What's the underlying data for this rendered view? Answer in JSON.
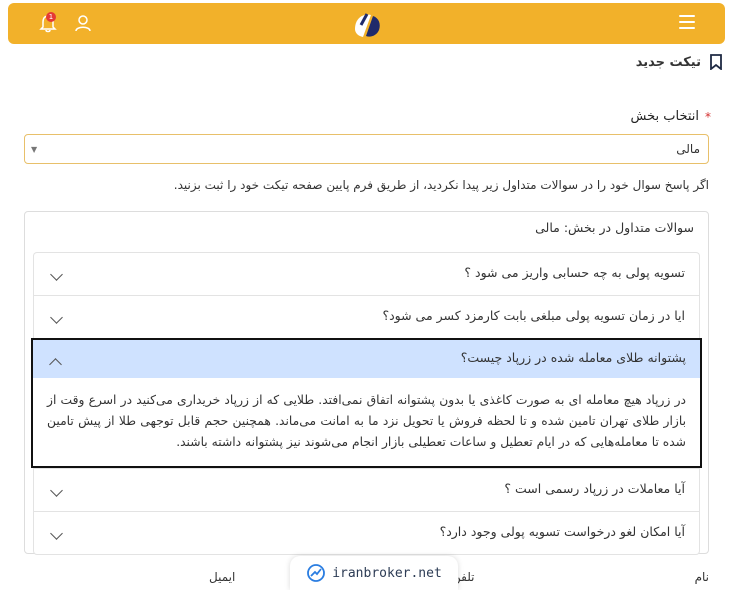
{
  "colors": {
    "header": "#f2b12a",
    "accent": "#cfe2ff",
    "required": "#d32f2f"
  },
  "header": {
    "menu_icon": "hamburger-icon",
    "logo_icon": "brand-logo",
    "user_icon": "user-icon",
    "bell_icon": "bell-icon",
    "notification_count": "1"
  },
  "page": {
    "title": "تیکت جدید",
    "title_icon": "bookmark-icon"
  },
  "section": {
    "label": "انتخاب بخش",
    "required_mark": "*",
    "selected": "مالی"
  },
  "hint": "اگر پاسخ سوال خود را در سوالات متداول زیر پیدا نکردید، از طریق فرم پایین صفحه تیکت خود را ثبت بزنید.",
  "faq": {
    "title": "سوالات متداول در بخش: مالی",
    "items": [
      {
        "question": "تسویه پولی به چه حسابی واریز می شود ؟",
        "expanded": false
      },
      {
        "question": "ایا در زمان تسویه پولی مبلغی بابت کارمزد کسر می شود؟",
        "expanded": false
      },
      {
        "question": "پشتوانه طلای معامله شده در زرپاد چیست؟",
        "expanded": true,
        "answer": "در زرپاد هیچ معامله ای به صورت کاغذی یا بدون پشتوانه اتفاق نمی‌افتد. طلایی که از زرپاد خریداری می‌کنید در اسرع وقت از بازار طلای تهران تامین شده و تا لحظه فروش یا تحویل نزد ما به امانت می‌ماند. همچنین حجم قابل توجهی طلا از پیش تامین شده تا معامله‌هایی که در ایام تعطیل و ساعات تعطیلی بازار انجام می‌شوند نیز پشتوانه داشته باشند."
      },
      {
        "question": "آیا معاملات در زرپاد رسمی است ؟",
        "expanded": false
      },
      {
        "question": "آیا امکان لغو درخواست تسویه پولی وجود دارد؟",
        "expanded": false
      }
    ]
  },
  "form_labels": {
    "name": "نام",
    "phone": "تلفن",
    "email": "ایمیل"
  },
  "watermark": "iranbroker.net"
}
